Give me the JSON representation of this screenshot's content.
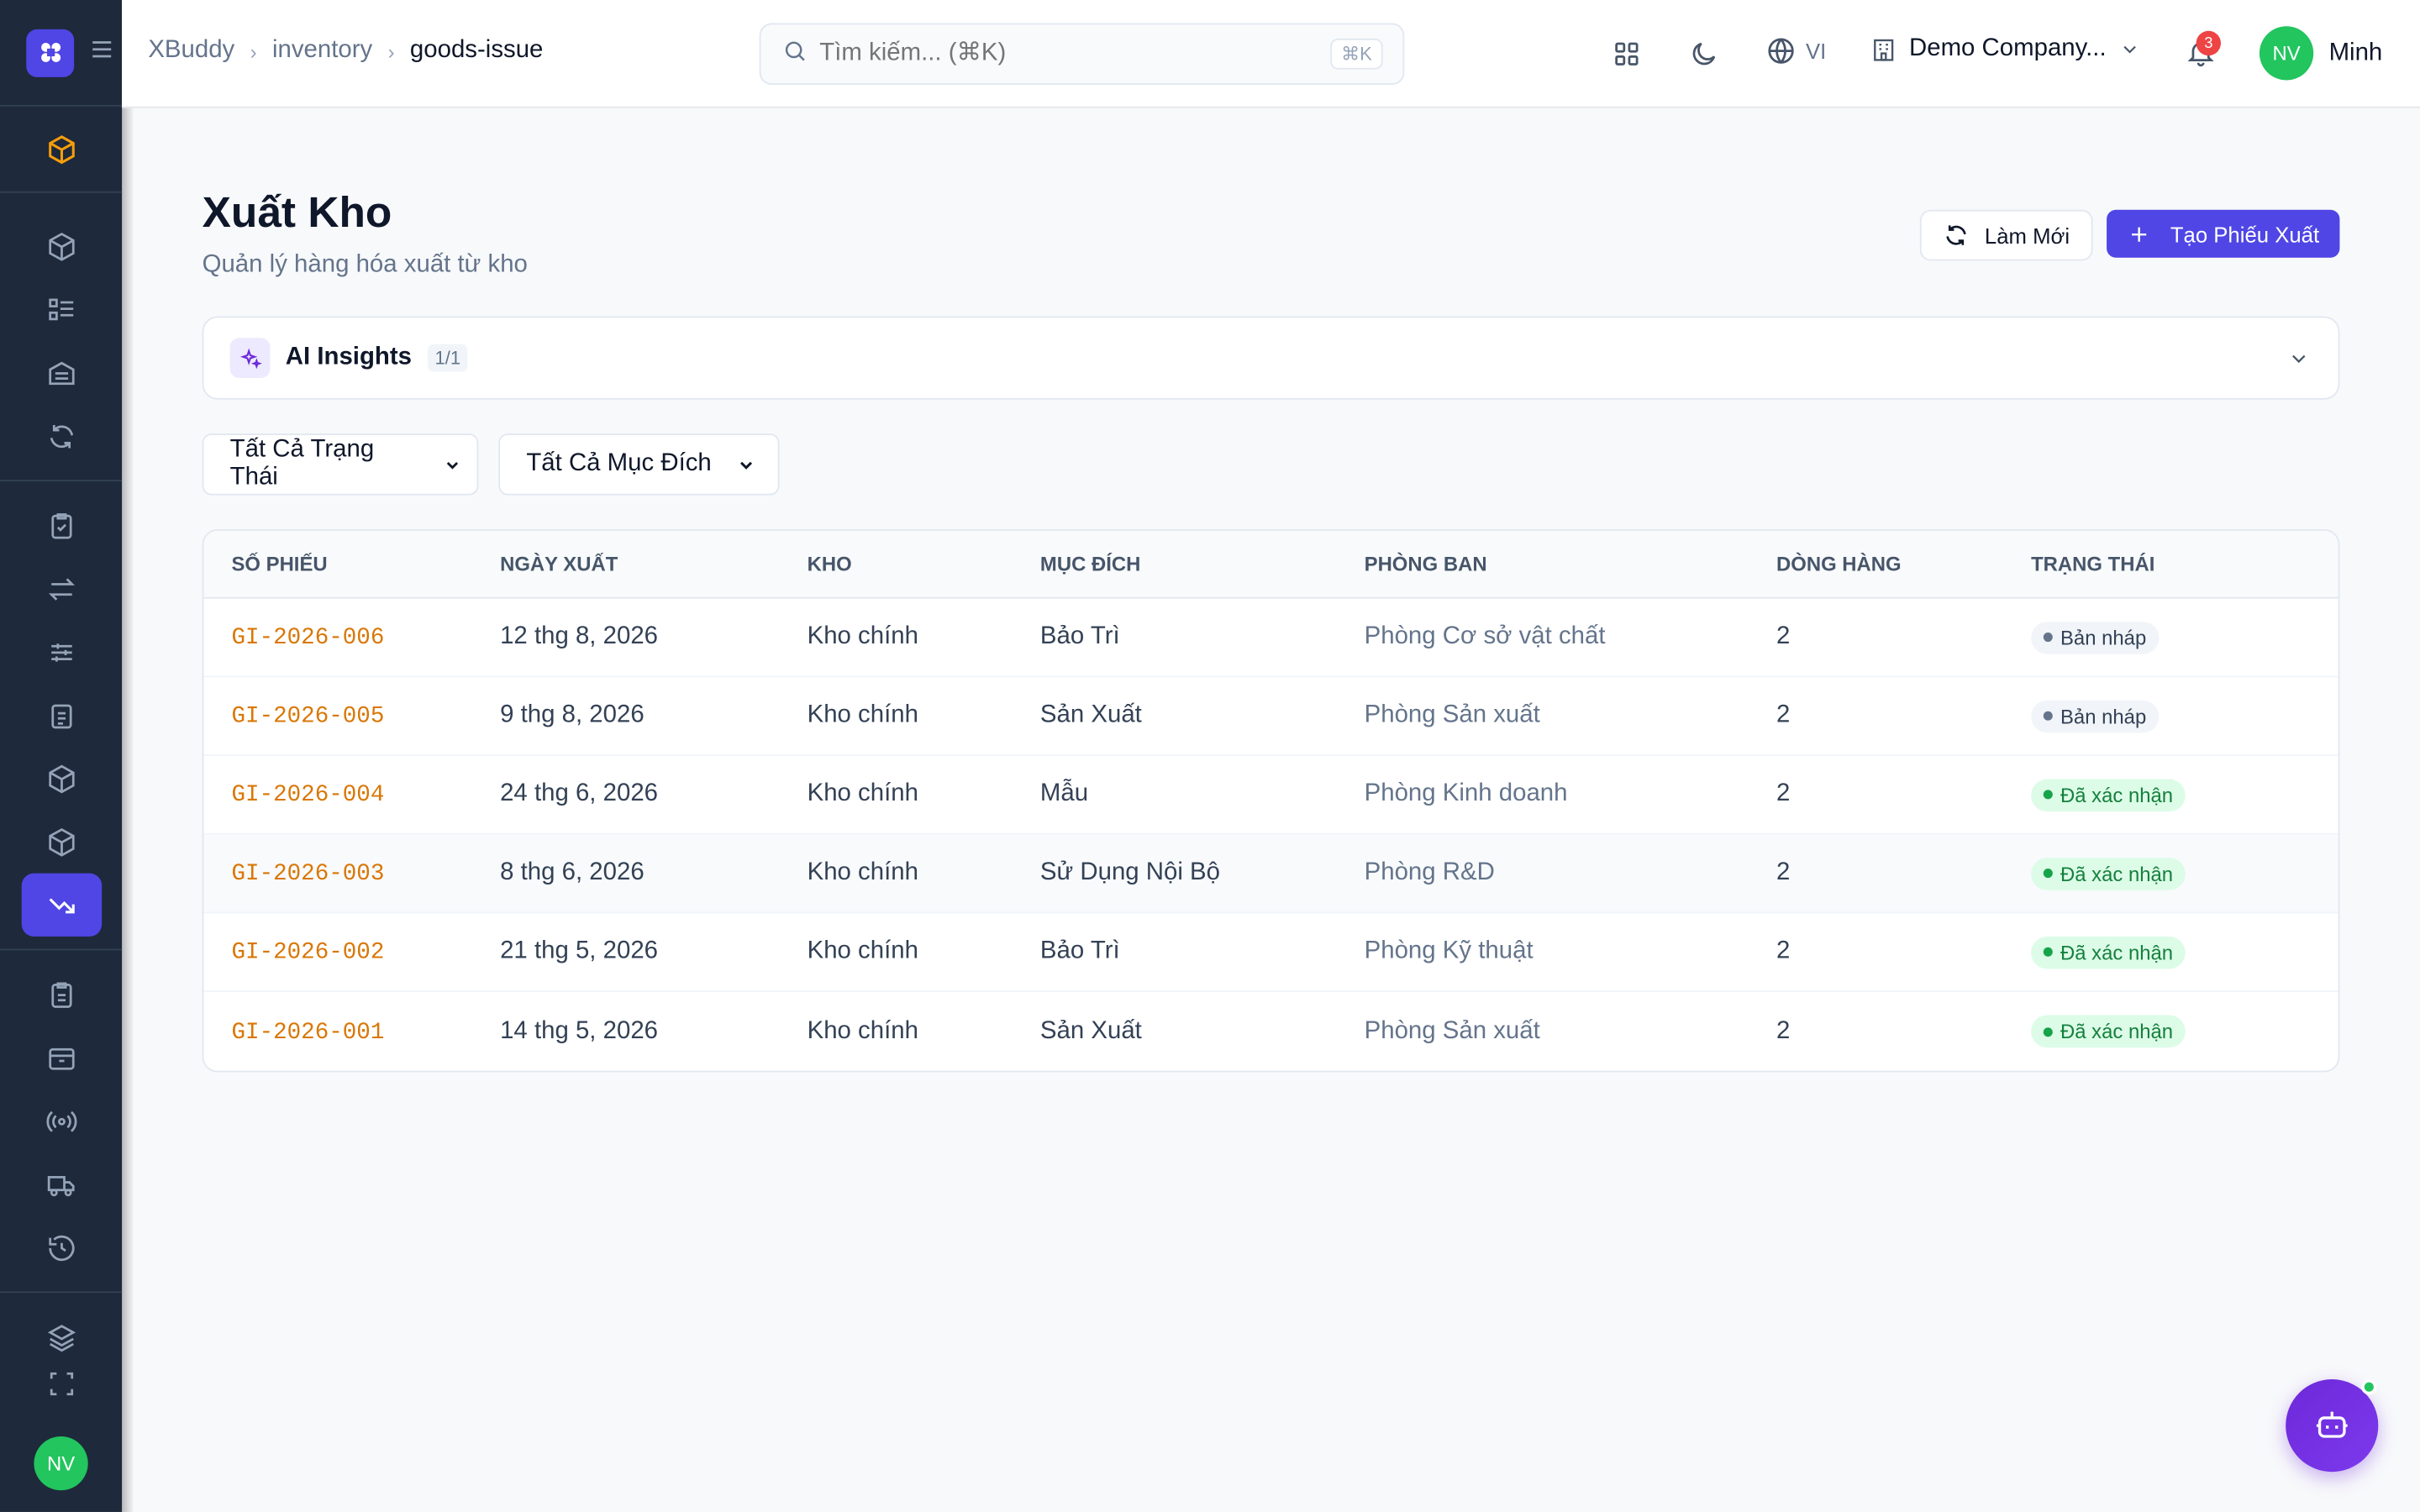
{
  "header": {
    "breadcrumb": [
      "XBuddy",
      "inventory",
      "goods-issue"
    ],
    "search_placeholder": "Tìm kiếm... (⌘K)",
    "search_kbd": "⌘K",
    "language": "VI",
    "company": "Demo Company...",
    "notification_count": "3",
    "user_initials": "NV",
    "user_name": "Minh"
  },
  "sidebar": {
    "avatar_initials": "NV",
    "active_item": "goods-issue"
  },
  "page": {
    "title": "Xuất Kho",
    "subtitle": "Quản lý hàng hóa xuất từ kho",
    "refresh_label": "Làm Mới",
    "create_label": "Tạo Phiếu Xuất"
  },
  "ai_insights": {
    "label": "AI Insights",
    "count": "1/1"
  },
  "filters": {
    "status": "Tất Cả Trạng Thái",
    "purpose": "Tất Cả Mục Đích"
  },
  "table": {
    "columns": [
      "SỐ PHIẾU",
      "NGÀY XUẤT",
      "KHO",
      "MỤC ĐÍCH",
      "PHÒNG BAN",
      "DÒNG HÀNG",
      "TRẠNG THÁI"
    ],
    "rows": [
      {
        "code": "GI-2026-006",
        "date": "12 thg 8, 2026",
        "warehouse": "Kho chính",
        "purpose": "Bảo Trì",
        "dept": "Phòng Cơ sở vật chất",
        "lines": "2",
        "status": "Bản nháp"
      },
      {
        "code": "GI-2026-005",
        "date": "9 thg 8, 2026",
        "warehouse": "Kho chính",
        "purpose": "Sản Xuất",
        "dept": "Phòng Sản xuất",
        "lines": "2",
        "status": "Bản nháp"
      },
      {
        "code": "GI-2026-004",
        "date": "24 thg 6, 2026",
        "warehouse": "Kho chính",
        "purpose": "Mẫu",
        "dept": "Phòng Kinh doanh",
        "lines": "2",
        "status": "Đã xác nhận"
      },
      {
        "code": "GI-2026-003",
        "date": "8 thg 6, 2026",
        "warehouse": "Kho chính",
        "purpose": "Sử Dụng Nội Bộ",
        "dept": "Phòng R&D",
        "lines": "2",
        "status": "Đã xác nhận"
      },
      {
        "code": "GI-2026-002",
        "date": "21 thg 5, 2026",
        "warehouse": "Kho chính",
        "purpose": "Bảo Trì",
        "dept": "Phòng Kỹ thuật",
        "lines": "2",
        "status": "Đã xác nhận"
      },
      {
        "code": "GI-2026-001",
        "date": "14 thg 5, 2026",
        "warehouse": "Kho chính",
        "purpose": "Sản Xuất",
        "dept": "Phòng Sản xuất",
        "lines": "2",
        "status": "Đã xác nhận"
      }
    ]
  },
  "colors": {
    "accent": "#4f46e5",
    "sidebar": "#1e293b",
    "code": "#d97706",
    "draft_bg": "#f1f5f9",
    "confirmed_bg": "#dcfce7"
  }
}
